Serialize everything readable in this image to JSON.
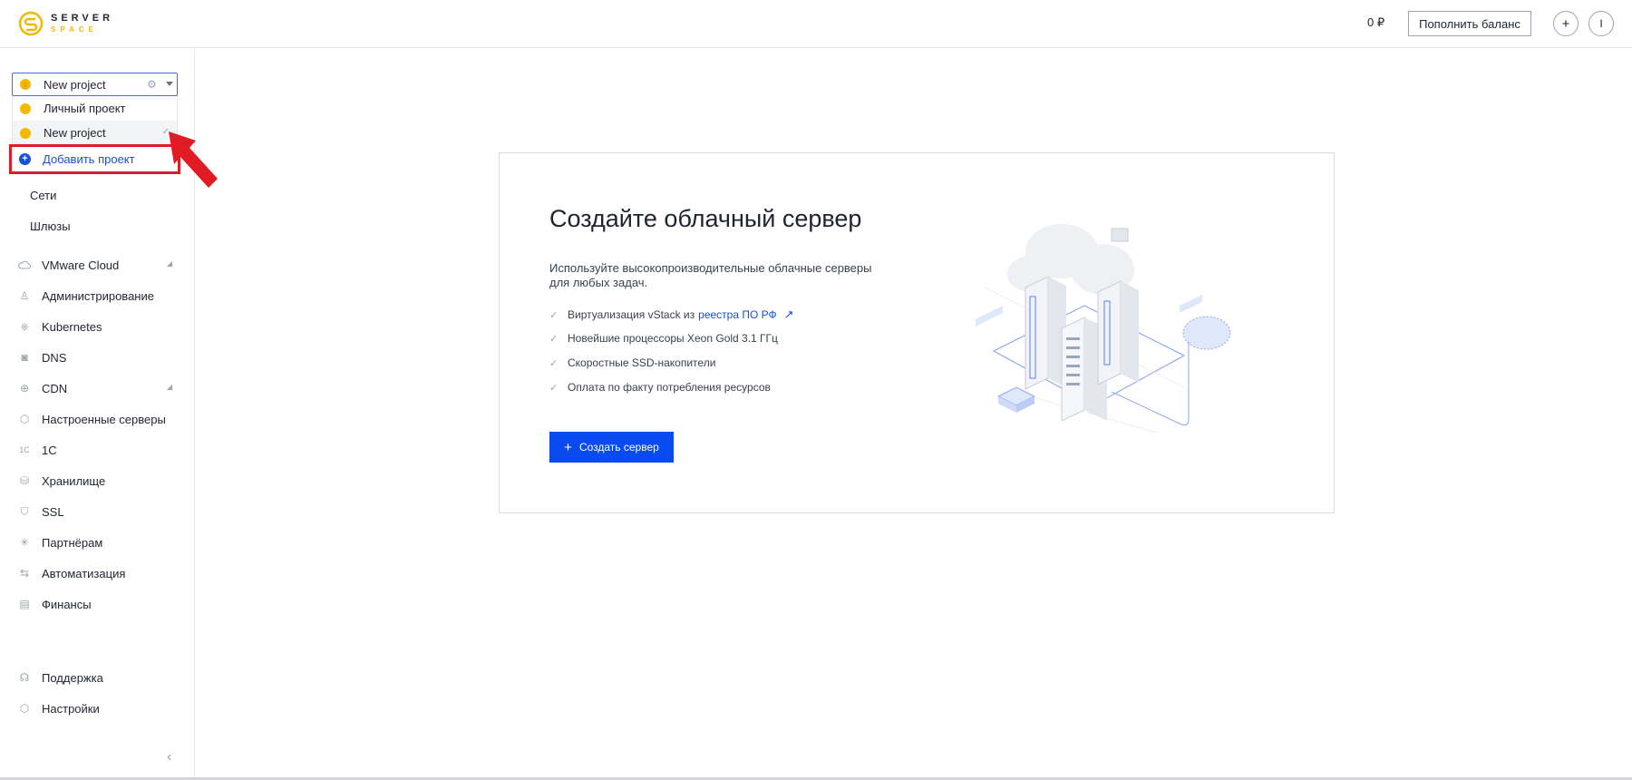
{
  "header": {
    "logo_line1": "SERVER",
    "logo_line2": "SPACE",
    "balance": "0 ₽",
    "topup_label": "Пополнить баланс",
    "plus_label": "+",
    "user_initial": "I"
  },
  "project": {
    "current": "New project",
    "dropdown": [
      {
        "label": "Личный проект"
      },
      {
        "label": "New project",
        "selected": true
      }
    ],
    "add_label": "Добавить проект"
  },
  "sidebar": {
    "sub_items": [
      "Сети",
      "Шлюзы"
    ],
    "items": [
      {
        "label": "VMware Cloud",
        "icon": "cloud-icon",
        "expandable": true
      },
      {
        "label": "Администрирование",
        "icon": "user-admin-icon"
      },
      {
        "label": "Kubernetes",
        "icon": "kubernetes-icon"
      },
      {
        "label": "DNS",
        "icon": "dns-icon"
      },
      {
        "label": "CDN",
        "icon": "globe-icon",
        "expandable": true
      },
      {
        "label": "Настроенные серверы",
        "icon": "box-icon"
      },
      {
        "label": "1С",
        "icon": "one-c-icon"
      },
      {
        "label": "Хранилище",
        "icon": "database-icon"
      },
      {
        "label": "SSL",
        "icon": "shield-icon"
      },
      {
        "label": "Партнёрам",
        "icon": "asterisk-icon"
      },
      {
        "label": "Автоматизация",
        "icon": "arrows-icon"
      },
      {
        "label": "Финансы",
        "icon": "document-icon"
      }
    ],
    "bottom": [
      {
        "label": "Поддержка",
        "icon": "headset-icon"
      },
      {
        "label": "Настройки",
        "icon": "settings-icon"
      }
    ]
  },
  "main": {
    "title": "Создайте облачный сервер",
    "description": "Используйте высокопроизводительные облачные серверы для любых задач.",
    "features": [
      {
        "text": "Виртуализация vStack из",
        "link": "реестра ПО РФ"
      },
      {
        "text": "Новейшие процессоры Xeon Gold 3.1 ГГц"
      },
      {
        "text": "Скоростные SSD-накопители"
      },
      {
        "text": "Оплата по факту потребления ресурсов"
      }
    ],
    "create_button": "Создать сервер"
  },
  "colors": {
    "accent": "#0a4bf0",
    "link": "#1650d8",
    "brand_yellow": "#f5b800",
    "highlight_red": "#e01b24"
  }
}
